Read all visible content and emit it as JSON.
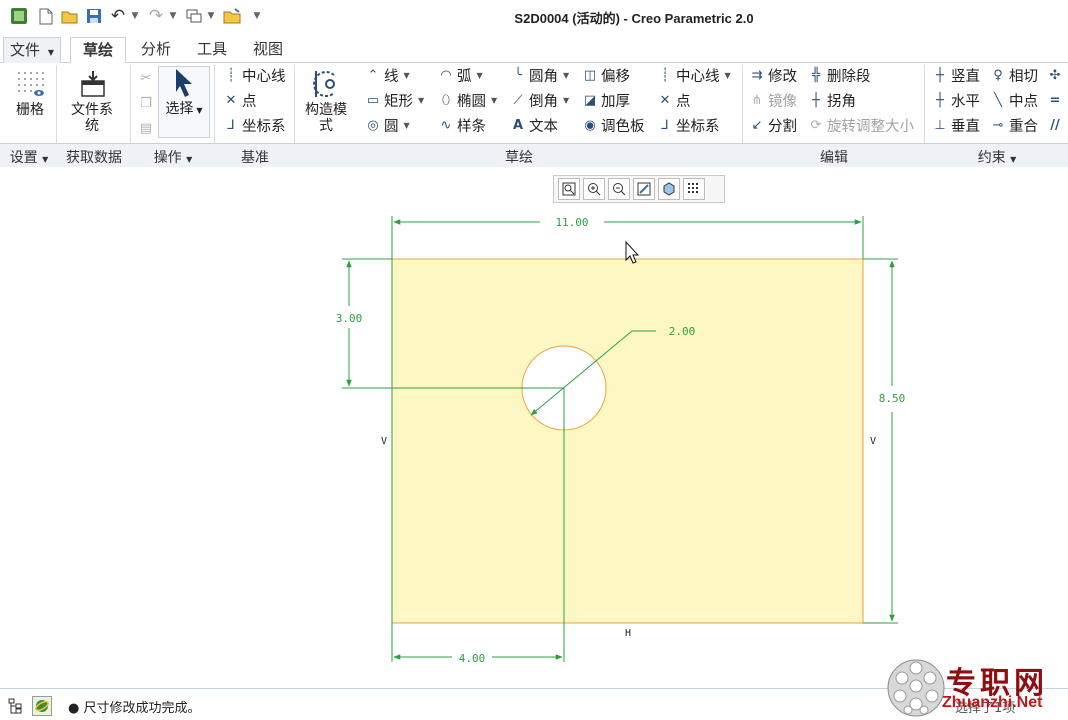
{
  "window": {
    "title": "S2D0004 (活动的) - Creo Parametric 2.0"
  },
  "menu": {
    "tabs": [
      {
        "label": "文件",
        "has_dropdown": true
      },
      {
        "label": "草绘",
        "active": true
      },
      {
        "label": "分析"
      },
      {
        "label": "工具"
      },
      {
        "label": "视图"
      }
    ]
  },
  "ribbon": {
    "grid": "栅格",
    "file_system": "文件系统",
    "select": "选择",
    "datum": {
      "centerline": "中心线",
      "point": "点",
      "csys": "坐标系"
    },
    "construction_mode": "构造模式",
    "sketch": {
      "line": "线",
      "rectangle": "矩形",
      "circle": "圆",
      "arc": "弧",
      "ellipse": "椭圆",
      "spline": "样条",
      "fillet": "圆角",
      "chamfer": "倒角",
      "text": "文本",
      "offset": "偏移",
      "thicken": "加厚",
      "palette": "调色板",
      "centerline": "中心线",
      "point": "点",
      "csys": "坐标系"
    },
    "edit": {
      "modify": "修改",
      "mirror": "镜像",
      "divide": "分割",
      "delete_segment": "删除段",
      "corner": "拐角",
      "rotate_resize": "旋转调整大小"
    },
    "constrain": {
      "vertical": "竖直",
      "horizontal": "水平",
      "perpendicular": "垂直",
      "tangent": "相切",
      "midpoint": "中点",
      "coincident": "重合"
    },
    "groups": {
      "setup": "设置",
      "get_data": "获取数据",
      "operations": "操作",
      "datum": "基准",
      "sketching": "草绘",
      "editing": "编辑",
      "constrain": "约束"
    }
  },
  "graphics_toolbar": {
    "icons": [
      "refit-icon",
      "zoom-in-icon",
      "zoom-out-icon",
      "repaint-icon",
      "display-style-icon",
      "sketcher-display-icon"
    ]
  },
  "sketch": {
    "dims": {
      "width": "11.00",
      "height": "8.50",
      "hole_from_top": "3.00",
      "hole_from_left": "4.00",
      "hole_diameter": "2.00"
    },
    "constraints": {
      "vertical_left": "V",
      "vertical_right": "V",
      "horizontal_bottom": "H"
    },
    "colors": {
      "fill": "#fdf8c3",
      "sketch": "#e8a23a",
      "dimension": "#2ea043",
      "constraint": "#222222"
    }
  },
  "status": {
    "message": "● 尺寸修改成功完成。",
    "right_text": "选择了1项"
  },
  "watermark": {
    "cn": "专职网",
    "en": "Zhuanzhi.Net"
  }
}
